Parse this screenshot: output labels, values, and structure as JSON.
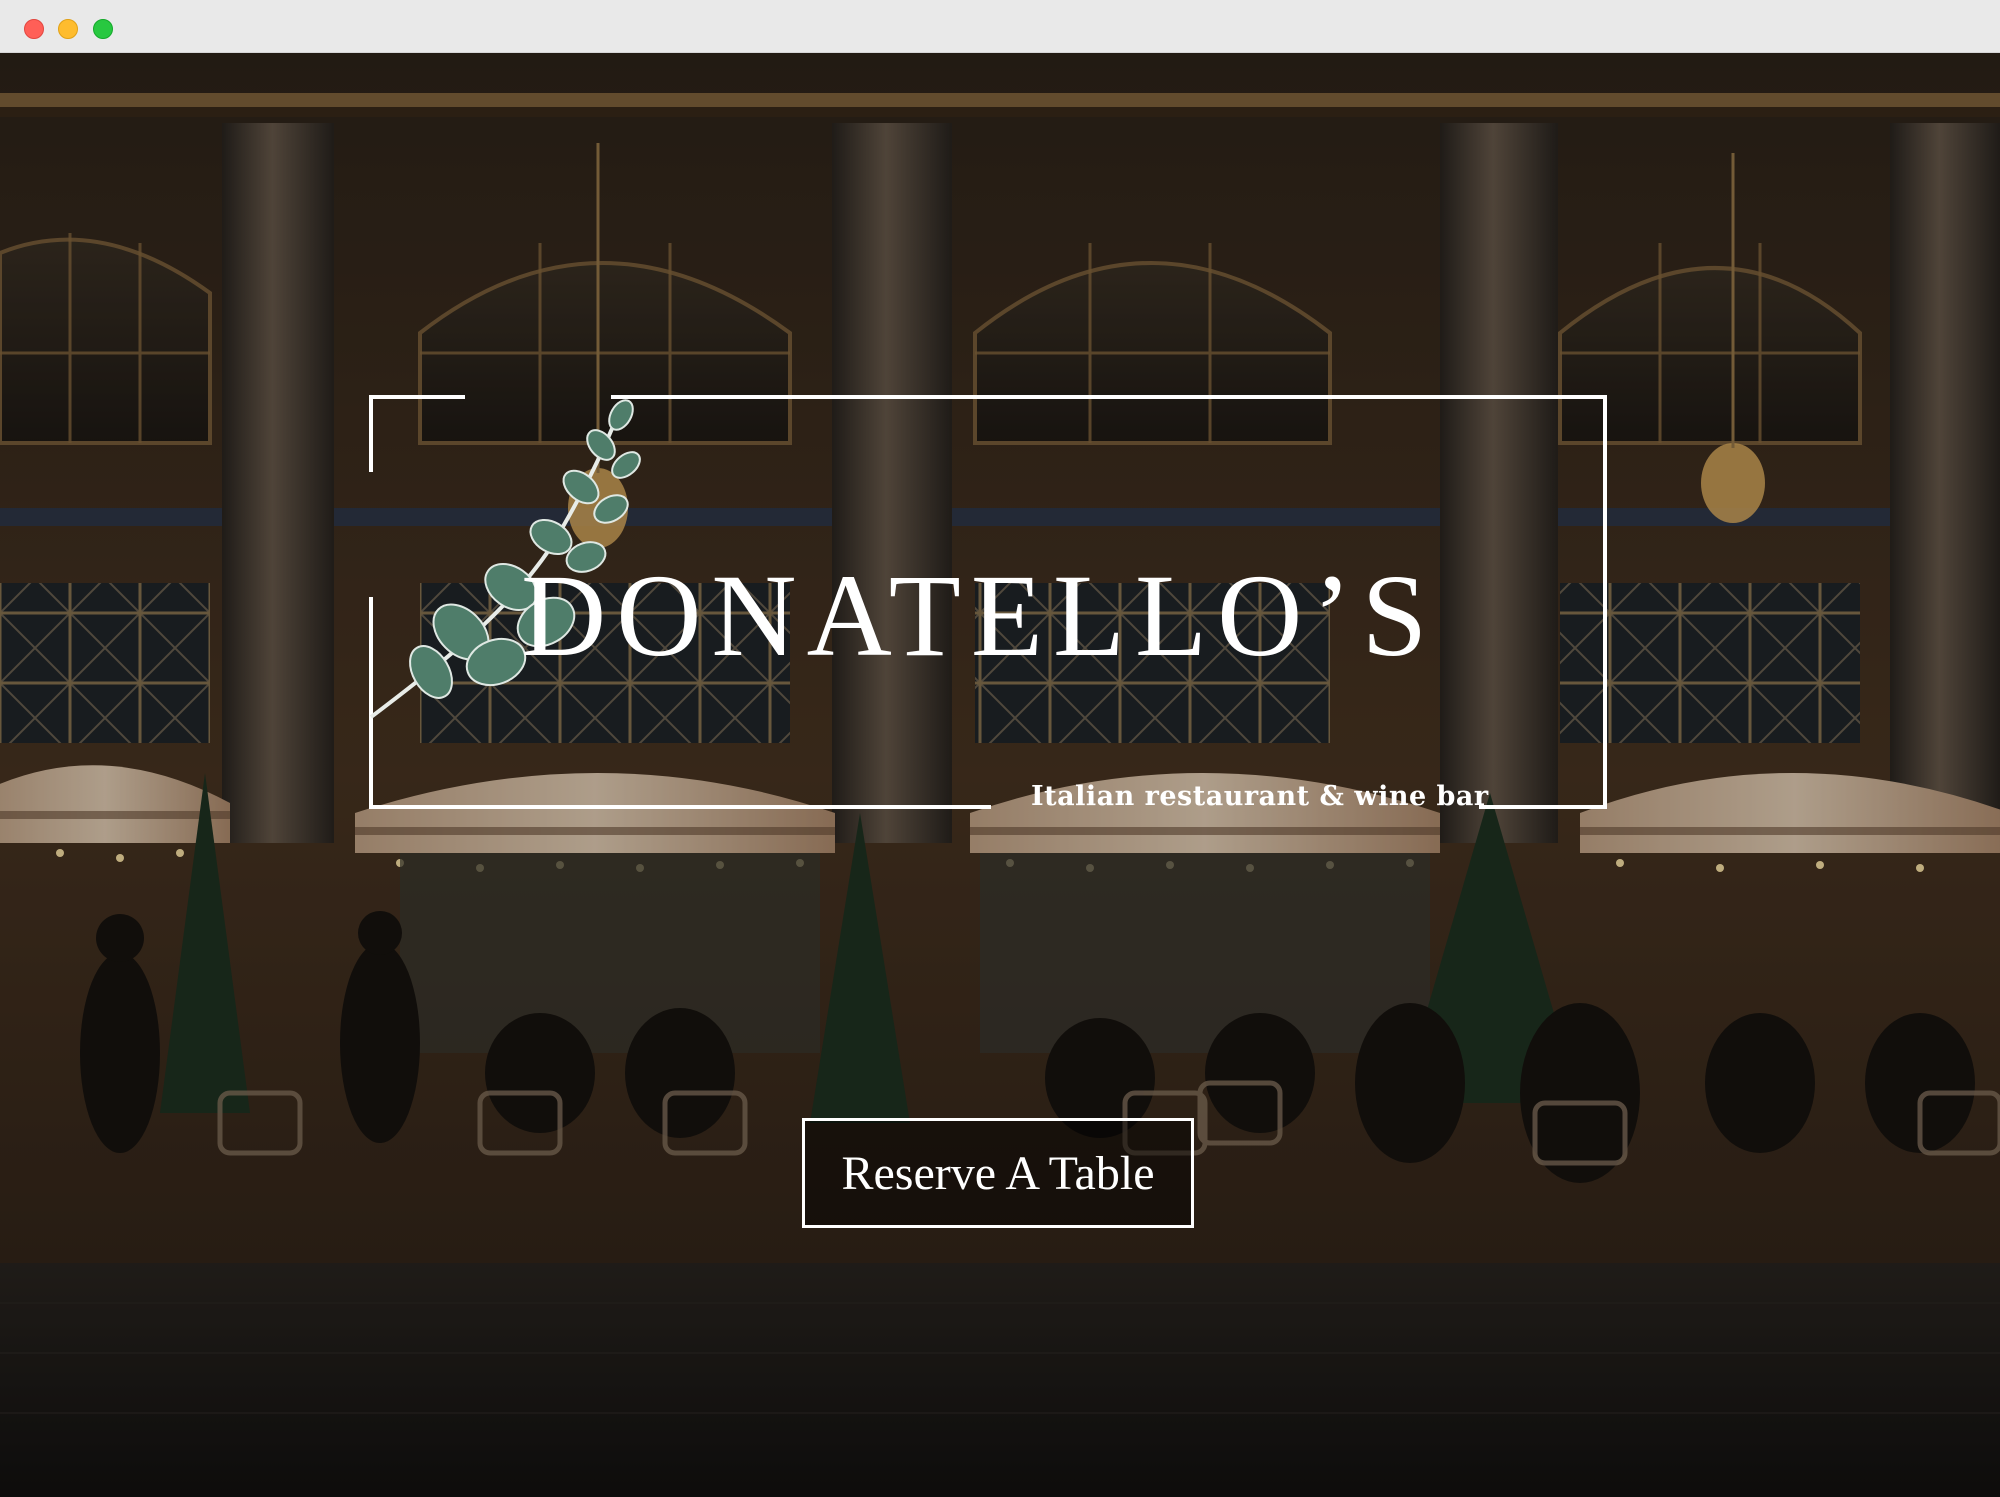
{
  "window": {
    "controls": [
      "close",
      "minimize",
      "zoom"
    ],
    "colors": {
      "close": "#ff5f57",
      "minimize": "#febc2e",
      "zoom": "#28c840"
    }
  },
  "hero": {
    "background_description_icon": "restaurant-terrace-photo",
    "logo": {
      "name": "DONATELLO’S",
      "tagline": "Italian restaurant & wine bar",
      "ornament_icon": "eucalyptus-branch-icon",
      "accent_color": "#4f7d6a"
    },
    "cta": {
      "label": "Reserve A Table"
    }
  }
}
